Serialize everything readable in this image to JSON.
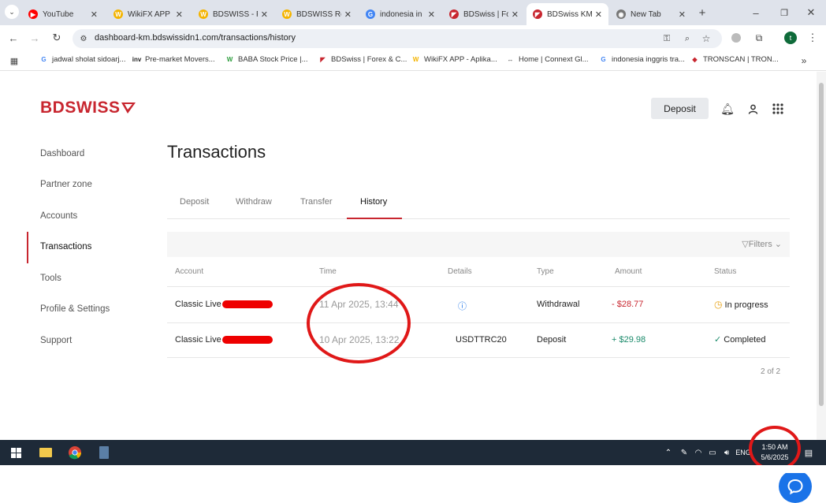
{
  "browser": {
    "tabs": [
      {
        "title": "YouTube",
        "color": "#ff0000",
        "glyph": "▶"
      },
      {
        "title": "WikiFX APP",
        "color": "#f4b400",
        "glyph": "W"
      },
      {
        "title": "BDSWISS - P",
        "color": "#f4b400",
        "glyph": "W"
      },
      {
        "title": "BDSWISS Re",
        "color": "#f4b400",
        "glyph": "W"
      },
      {
        "title": "indonesia in",
        "color": "#4285f4",
        "glyph": "G"
      },
      {
        "title": "BDSwiss | Fo",
        "color": "#c8262f",
        "glyph": "◤"
      },
      {
        "title": "BDSwiss KM",
        "color": "#c8262f",
        "glyph": "◤"
      },
      {
        "title": "New Tab",
        "color": "#777777",
        "glyph": "◉"
      }
    ],
    "url": "dashboard-km.bdswissidn1.com/transactions/history",
    "bookmarks": [
      {
        "label": "jadwal sholat sidoarj...",
        "color": "#4285f4",
        "glyph": "G"
      },
      {
        "label": "Pre-market Movers...",
        "color": "#222222",
        "glyph": "inv"
      },
      {
        "label": "BABA Stock Price |...",
        "color": "#2e9e3e",
        "glyph": "W"
      },
      {
        "label": "BDSwiss | Forex & C...",
        "color": "#c8262f",
        "glyph": "◤"
      },
      {
        "label": "WikiFX APP - Aplika...",
        "color": "#f4b400",
        "glyph": "W"
      },
      {
        "label": "Home | Connext Gl...",
        "color": "#555555",
        "glyph": "↔"
      },
      {
        "label": "indonesia inggris tra...",
        "color": "#4285f4",
        "glyph": "G"
      },
      {
        "label": "TRONSCAN | TRON...",
        "color": "#c8262f",
        "glyph": "◆"
      }
    ],
    "profile_initial": "t"
  },
  "app": {
    "logo": "BDSWISS",
    "deposit_button": "Deposit",
    "nav": [
      "Dashboard",
      "Partner zone",
      "Accounts",
      "Transactions",
      "Tools",
      "Profile & Settings",
      "Support"
    ],
    "active_nav": "Transactions",
    "page_title": "Transactions",
    "subtabs": [
      "Deposit",
      "Withdraw",
      "Transfer",
      "History"
    ],
    "active_subtab": "History",
    "filters_label": "Filters",
    "columns": [
      "Account",
      "Time",
      "Details",
      "Type",
      "Amount",
      "Status"
    ],
    "rows": [
      {
        "account": "Classic Live -",
        "time": "11 Apr 2025, 13:44",
        "details": "ⓘ",
        "type": "Withdrawal",
        "amount": "- $28.77",
        "status": "In progress",
        "status_icon": "clock"
      },
      {
        "account": "Classic Live -",
        "time": "10 Apr 2025, 13:22",
        "details": "USDTTRC20",
        "type": "Deposit",
        "amount": "+ $29.98",
        "status": "Completed",
        "status_icon": "check"
      }
    ],
    "pager": "2 of 2"
  },
  "taskbar": {
    "time": "1:50 AM",
    "date": "5/6/2025",
    "lang": "ENG"
  }
}
